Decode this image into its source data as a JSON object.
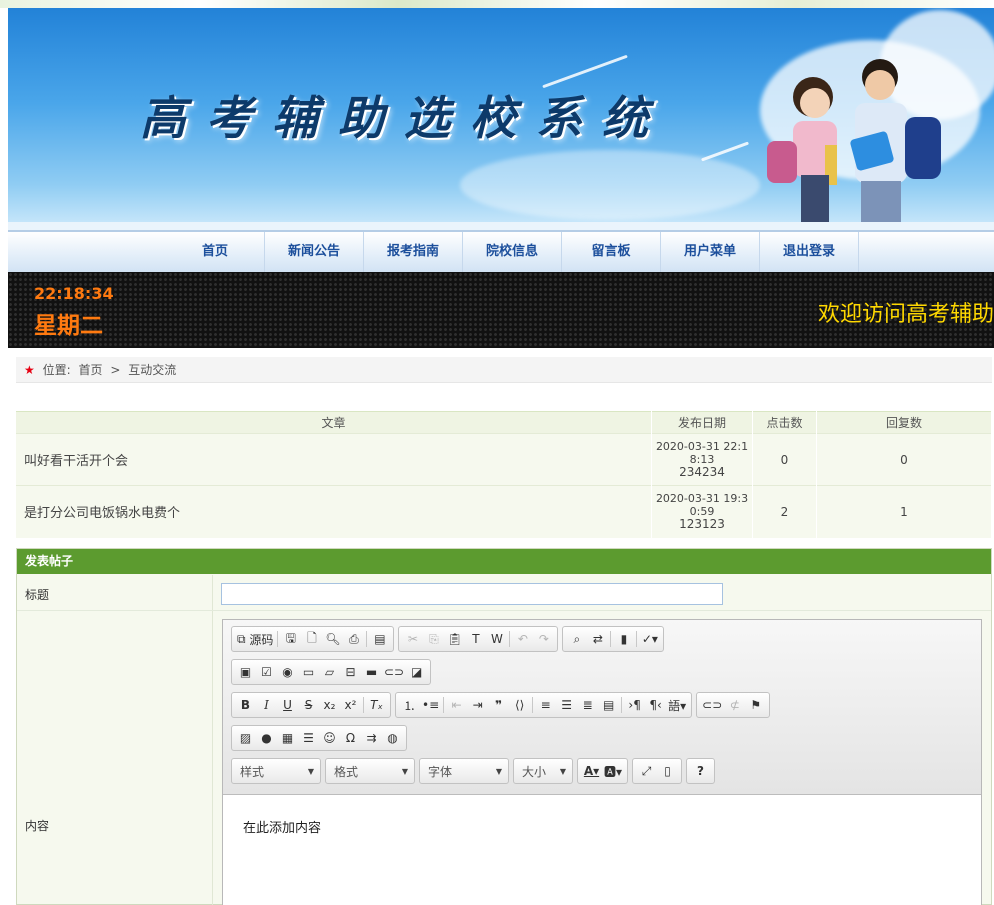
{
  "banner": {
    "title": "高考辅助选校系统"
  },
  "nav": {
    "items": [
      "首页",
      "新闻公告",
      "报考指南",
      "院校信息",
      "留言板",
      "用户菜单",
      "退出登录"
    ]
  },
  "led": {
    "time": "22:18:34",
    "weekday": "星期二",
    "marquee": "欢迎访问高考辅助"
  },
  "breadcrumb": {
    "prefix": "位置:",
    "home": "首页",
    "separator": ">",
    "current": "互动交流",
    "star_color": "#e60012"
  },
  "table": {
    "headers": {
      "article": "文章",
      "date": "发布日期",
      "clicks": "点击数",
      "replies": "回复数"
    },
    "rows": [
      {
        "title": "叫好看干活开个会",
        "date_line1": "2020-03-31 22:1",
        "date_line2": "8:13",
        "author": "234234",
        "clicks": "0",
        "replies": "0"
      },
      {
        "title": "是打分公司电饭锅水电费个",
        "date_line1": "2020-03-31 19:3",
        "date_line2": "0:59",
        "author": "123123",
        "clicks": "2",
        "replies": "1"
      }
    ]
  },
  "form": {
    "header": "发表帖子",
    "title_label": "标题",
    "title_value": "",
    "content_label": "内容",
    "editor": {
      "source_label": "源码",
      "combos": {
        "style": "样式",
        "format": "格式",
        "font": "字体",
        "size": "大小"
      },
      "content": "在此添加内容"
    }
  },
  "colors": {
    "form_header": "#5c9b2f",
    "nav_text": "#1c4f9c",
    "led_time": "#ff7a10",
    "led_marquee": "#ffd800"
  }
}
